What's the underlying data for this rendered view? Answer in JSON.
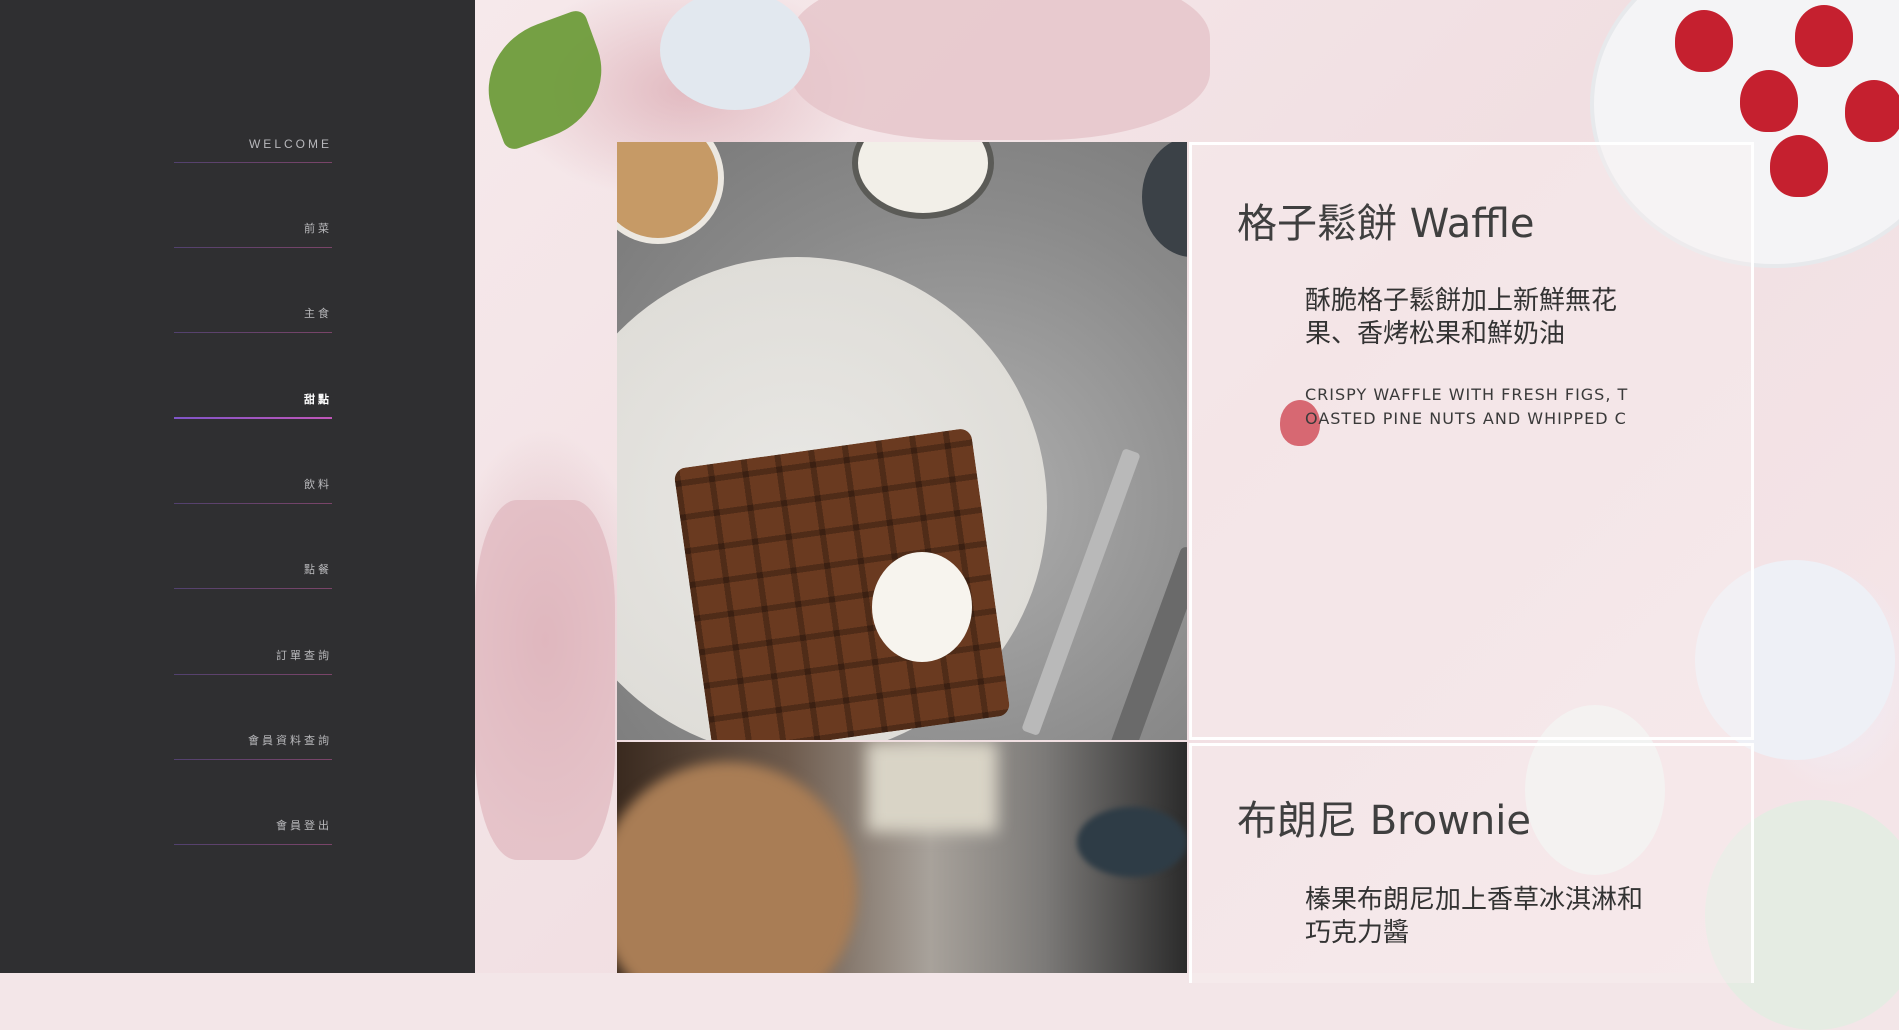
{
  "sidebar": {
    "items": [
      {
        "label": "WELCOME",
        "active": false
      },
      {
        "label": "前菜",
        "active": false
      },
      {
        "label": "主食",
        "active": false
      },
      {
        "label": "甜點",
        "active": true
      },
      {
        "label": "飲料",
        "active": false
      },
      {
        "label": "點餐",
        "active": false
      },
      {
        "label": "訂單查詢",
        "active": false
      },
      {
        "label": "會員資料查詢",
        "active": false
      },
      {
        "label": "會員登出",
        "active": false
      }
    ]
  },
  "menu": {
    "items": [
      {
        "title": "格子鬆餅 Waffle",
        "desc_zh": "酥脆格子鬆餅加上新鮮無花果、香烤松果和鮮奶油",
        "desc_en": "CRISPY WAFFLE WITH FRESH FIGS, TOASTED PINE NUTS AND WHIPPED C"
      },
      {
        "title": "布朗尼 Brownie",
        "desc_zh": "榛果布朗尼加上香草冰淇淋和巧克力醬"
      }
    ]
  },
  "colors": {
    "sidebar_bg": "#2f2f31",
    "active_accent": "#c056b8",
    "card_border": "#ffffff"
  }
}
